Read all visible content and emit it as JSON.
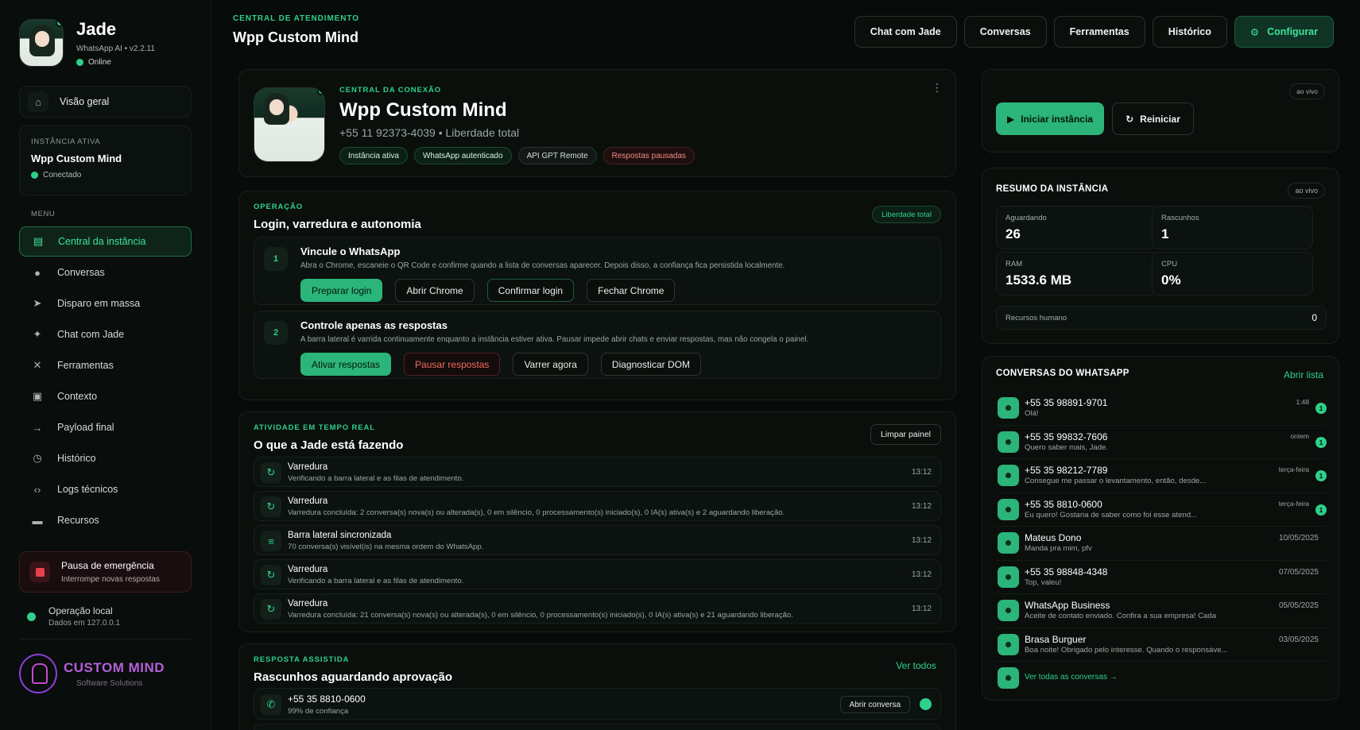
{
  "sidebar": {
    "brand": {
      "name": "Jade",
      "version": "WhatsApp AI • v2.2.11",
      "status": "Online"
    },
    "overview": "Visão geral",
    "instance": {
      "caption": "INSTÂNCIA ATIVA",
      "name": "Wpp Custom Mind",
      "status": "Conectado"
    },
    "menu_caption": "MENU",
    "menu": [
      {
        "label": "Central da instância",
        "icon": "panel-icon",
        "glyph": "▤",
        "active": true
      },
      {
        "label": "Conversas",
        "icon": "chat-icon",
        "glyph": "●"
      },
      {
        "label": "Disparo em massa",
        "icon": "send-icon",
        "glyph": "➤"
      },
      {
        "label": "Chat com Jade",
        "icon": "sparkle-icon",
        "glyph": "✦"
      },
      {
        "label": "Ferramentas",
        "icon": "tools-icon",
        "glyph": "✕"
      },
      {
        "label": "Contexto",
        "icon": "document-icon",
        "glyph": "▣"
      },
      {
        "label": "Payload final",
        "icon": "arrow-right-icon",
        "glyph": "→"
      },
      {
        "label": "Histórico",
        "icon": "clock-icon",
        "glyph": "◷"
      },
      {
        "label": "Logs técnicos",
        "icon": "code-icon",
        "glyph": "‹›"
      },
      {
        "label": "Recursos",
        "icon": "folder-icon",
        "glyph": "▬"
      }
    ],
    "emergency": {
      "title": "Pausa de emergência",
      "desc": "Interrompe novas respostas"
    },
    "local": {
      "title": "Operação local",
      "desc": "Dados em 127.0.0.1"
    },
    "logo": {
      "title": "CUSTOM MIND",
      "subtitle": "Software Solutions"
    }
  },
  "header": {
    "caption": "CENTRAL DE ATENDIMENTO",
    "title": "Wpp Custom Mind"
  },
  "topnav": [
    "Chat com Jade",
    "Conversas",
    "Ferramentas",
    "Histórico"
  ],
  "topnav_primary": "Configurar",
  "connection": {
    "caption": "CENTRAL DA CONEXÃO",
    "title": "Wpp Custom Mind",
    "phone": "+55 11 92373-4039  •  Liberdade total",
    "tags": [
      "Instância ativa",
      "WhatsApp autenticado",
      "API GPT Remote",
      "Respostas pausadas"
    ]
  },
  "operation": {
    "caption": "OPERAÇÃO",
    "title": "Login, varredura e autonomia",
    "pill": "Liberdade total",
    "steps": [
      {
        "num": "1",
        "title": "Vincule o WhatsApp",
        "desc": "Abra o Chrome, escaneie o QR Code e confirme quando a lista de conversas aparecer. Depois disso, a confiança fica persistida localmente.",
        "buttons": [
          "Preparar login",
          "Abrir Chrome",
          "Confirmar login",
          "Fechar Chrome"
        ]
      },
      {
        "num": "2",
        "title": "Controle apenas as respostas",
        "desc": "A barra lateral é varrida continuamente enquanto a instância estiver ativa. Pausar impede abrir chats e enviar respostas, mas não congela o painel.",
        "buttons": [
          "Ativar respostas",
          "Pausar respostas",
          "Varrer agora",
          "Diagnosticar DOM"
        ]
      }
    ]
  },
  "activity": {
    "caption": "ATIVIDADE EM TEMPO REAL",
    "title": "O que a Jade está fazendo",
    "clear": "Limpar painel",
    "items": [
      {
        "title": "Varredura",
        "desc": "Verificando a barra lateral e as filas de atendimento.",
        "time": "13:12",
        "glyph": "↻"
      },
      {
        "title": "Varredura",
        "desc": "Varredura concluída: 2 conversa(s) nova(s) ou alterada(s), 0 em silêncio, 0 processamento(s) iniciado(s), 0 IA(s) ativa(s) e 2 aguardando liberação.",
        "time": "13:12",
        "glyph": "↻"
      },
      {
        "title": "Barra lateral sincronizada",
        "desc": "70 conversa(s) visível(is) na mesma ordem do WhatsApp.",
        "time": "13:12",
        "glyph": "≡"
      },
      {
        "title": "Varredura",
        "desc": "Verificando a barra lateral e as filas de atendimento.",
        "time": "13:12",
        "glyph": "↻"
      },
      {
        "title": "Varredura",
        "desc": "Varredura concluída: 21 conversa(s) nova(s) ou alterada(s), 0 em silêncio, 0 processamento(s) iniciado(s), 0 IA(s) ativa(s) e 21 aguardando liberação.",
        "time": "13:12",
        "glyph": "↻"
      }
    ]
  },
  "drafts": {
    "caption": "RESPOSTA ASSISTIDA",
    "title": "Rascunhos aguardando aprovação",
    "see_all": "Ver todos",
    "items": [
      {
        "name": "+55 35 8810-0600",
        "desc": "99% de confiança",
        "action": "Abrir conversa"
      }
    ]
  },
  "controls": {
    "live": "ao vivo",
    "start": "Iniciar instância",
    "restart": "Reiniciar"
  },
  "summary": {
    "title": "RESUMO DA INSTÂNCIA",
    "live": "ao vivo",
    "metrics": [
      {
        "label": "Aguardando",
        "value": "26"
      },
      {
        "label": "Rascunhos",
        "value": "1"
      },
      {
        "label": "RAM",
        "value": "1533.6 MB"
      },
      {
        "label": "CPU",
        "value": "0%"
      }
    ],
    "human": {
      "label": "Recursos humano",
      "value": "0"
    }
  },
  "conversations": {
    "title": "CONVERSAS DO WHATSAPP",
    "open": "Abrir lista",
    "items": [
      {
        "name": "+55 35 98891-9701",
        "msg": "Olá!",
        "time": "1:48",
        "badge": "1"
      },
      {
        "name": "+55 35 99832-7606",
        "msg": "Quero saber mais, Jade.",
        "time": "ontem",
        "badge": "1"
      },
      {
        "name": "+55 35 98212-7789",
        "msg": "Consegue me passar o levantamento, então, desde...",
        "time": "terça-feira",
        "badge": "1"
      },
      {
        "name": "+55 35 8810-0600",
        "msg": "Eu quero! Gostaria de saber como foi esse atend...",
        "time": "terça-feira",
        "badge": "1"
      },
      {
        "name": "Mateus Dono",
        "msg": "Manda pra mim, pfv",
        "time": "10/05/2025"
      },
      {
        "name": "+55 35 98848-4348",
        "msg": "Top, valeu!",
        "time": "07/05/2025"
      },
      {
        "name": "WhatsApp Business",
        "msg": "Aceite de contato enviado. Confira a sua empresa! Cada",
        "time": "05/05/2025"
      },
      {
        "name": "Brasa Burguer",
        "msg": "Boa noite! Obrigado pelo interesse. Quando o responsáve...",
        "time": "03/05/2025"
      }
    ],
    "see_all": "Ver todas as conversas →"
  },
  "colors": {
    "accent": "#2fd08a",
    "background": "#070b09",
    "danger": "#e8404c"
  }
}
